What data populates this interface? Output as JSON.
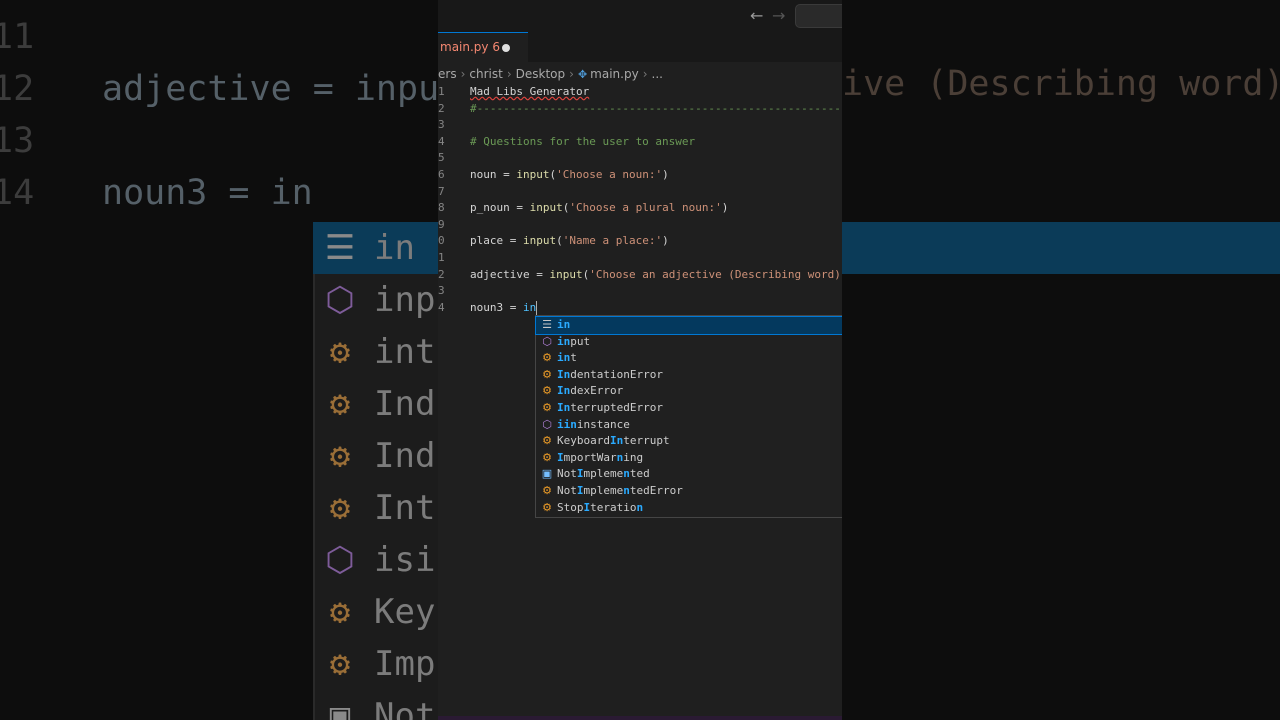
{
  "editor": {
    "nav": {
      "back_icon": "←",
      "forward_icon": "→"
    },
    "tab": {
      "label": "main.py 6"
    },
    "breadcrumb": {
      "part1": "ers",
      "part2": "christ",
      "part3": "Desktop",
      "file": "main.py",
      "more": "..."
    },
    "lines": [
      {
        "num": "1",
        "text": "Mad Libs Generator"
      },
      {
        "num": "2",
        "text": "#-------------------------------------------------------------"
      },
      {
        "num": "3",
        "text": ""
      },
      {
        "num": "4",
        "text": "# Questions for the user to answer"
      },
      {
        "num": "5",
        "text": ""
      },
      {
        "num": "6",
        "var": "noun",
        "eq": " = ",
        "fn": "input",
        "open": "(",
        "str": "'Choose a noun:'",
        "close": ")"
      },
      {
        "num": "7",
        "text": ""
      },
      {
        "num": "8",
        "var": "p_noun",
        "eq": " = ",
        "fn": "input",
        "open": "(",
        "str": "'Choose a plural noun:'",
        "close": ")"
      },
      {
        "num": "9",
        "text": ""
      },
      {
        "num": "0",
        "var": "place",
        "eq": " = ",
        "fn": "input",
        "open": "(",
        "str": "'Name a place:'",
        "close": ")"
      },
      {
        "num": "1",
        "text": ""
      },
      {
        "num": "2",
        "var": "adjective",
        "eq": " = ",
        "fn": "input",
        "open": "(",
        "str": "'Choose an adjective (Describing word)",
        "close": ""
      },
      {
        "num": "3",
        "text": ""
      },
      {
        "num": "4",
        "var": "noun3",
        "eq": " = ",
        "typed": "in"
      }
    ]
  },
  "suggestions": [
    {
      "pre": "",
      "hl": "in",
      "post": "",
      "icon": "keyword-icon",
      "glyph": "☰",
      "selected": true
    },
    {
      "pre": "",
      "hl": "in",
      "post": "put",
      "icon": "function-icon",
      "glyph": "⬡"
    },
    {
      "pre": "",
      "hl": "in",
      "post": "t",
      "icon": "class-icon",
      "glyph": "⚙"
    },
    {
      "pre": "",
      "hl": "In",
      "post": "dentationError",
      "icon": "class-icon",
      "glyph": "⚙"
    },
    {
      "pre": "",
      "hl": "In",
      "post": "dexError",
      "icon": "class-icon",
      "glyph": "⚙"
    },
    {
      "pre": "",
      "hl": "In",
      "post": "terruptedError",
      "icon": "class-icon",
      "glyph": "⚙"
    },
    {
      "pre": "",
      "hl": "i",
      "post": "sinstance",
      "icon": "function-icon",
      "glyph": "⬡",
      "hl2": "in",
      "split": 1
    },
    {
      "pre": "Keyboard",
      "hl": "In",
      "post": "terrupt",
      "icon": "class-icon",
      "glyph": "⚙"
    },
    {
      "pre": "",
      "hl": "I",
      "post": "mportWar",
      "icon": "class-icon",
      "glyph": "⚙",
      "tail_hl": "n",
      "tail": "ing"
    },
    {
      "pre": "Not",
      "hl": "I",
      "post": "mpleme",
      "icon": "constant-icon",
      "glyph": "▣",
      "tail_hl": "n",
      "tail": "ted"
    },
    {
      "pre": "Not",
      "hl": "I",
      "post": "mpleme",
      "icon": "class-icon",
      "glyph": "⚙",
      "tail_hl": "n",
      "tail": "tedError"
    },
    {
      "pre": "Stop",
      "hl": "I",
      "post": "teratio",
      "icon": "class-icon",
      "glyph": "⚙",
      "tail_hl": "n",
      "tail": ""
    }
  ],
  "background": {
    "left_lines": [
      {
        "num": "11",
        "text": ""
      },
      {
        "num": "12",
        "text": "adjective = inpu"
      },
      {
        "num": "13",
        "text": ""
      },
      {
        "num": "14",
        "text": "noun3 = in"
      }
    ],
    "left_items": [
      "in",
      "inp",
      "int",
      "Ind",
      "Ind",
      "Int",
      "isi",
      "Key",
      "Imp",
      "Not"
    ],
    "right_text": "ive (Describing word)"
  }
}
